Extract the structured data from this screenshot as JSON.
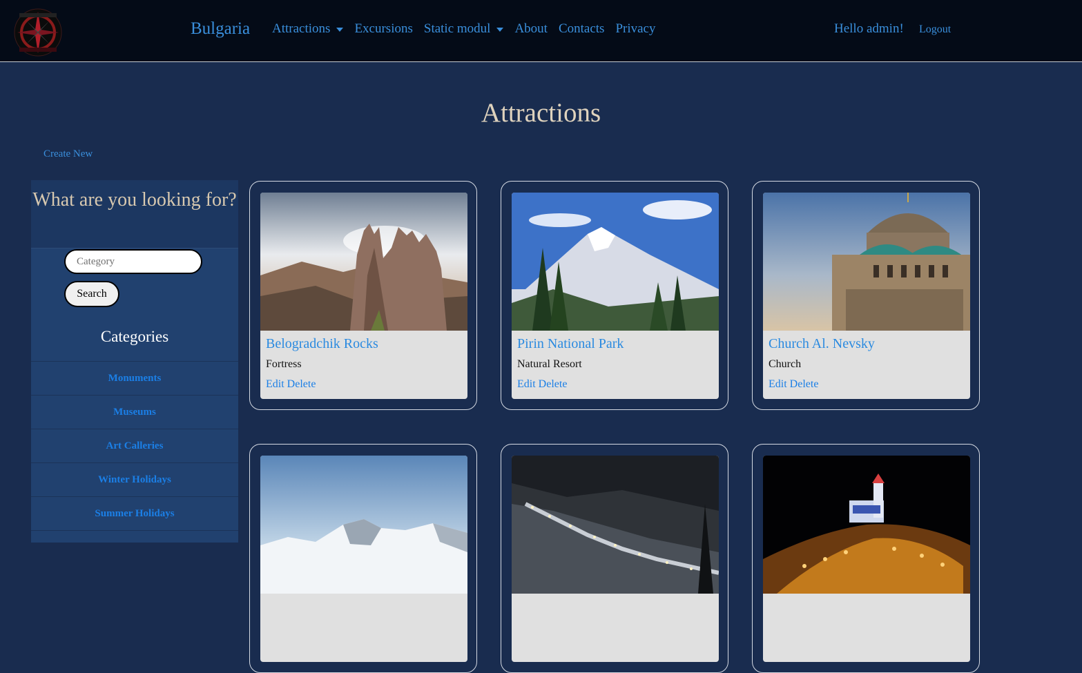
{
  "nav": {
    "brand": "Bulgaria",
    "links": [
      {
        "label": "Attractions",
        "dropdown": true
      },
      {
        "label": "Excursions",
        "dropdown": false
      },
      {
        "label": "Static modul",
        "dropdown": true
      },
      {
        "label": "About",
        "dropdown": false
      },
      {
        "label": "Contacts",
        "dropdown": false
      },
      {
        "label": "Privacy",
        "dropdown": false
      }
    ],
    "greeting": "Hello admin!",
    "logout": "Logout"
  },
  "page": {
    "title": "Attractions",
    "create_new": "Create New"
  },
  "sidebar": {
    "heading": "What are you looking for?",
    "search": {
      "placeholder": "Category",
      "value": "",
      "button": "Search"
    },
    "categories_title": "Categories",
    "categories": [
      "Monuments",
      "Museums",
      "Art Calleries",
      "Winter Holidays",
      "Summer Holidays"
    ]
  },
  "cards": [
    {
      "title": "Belogradchik Rocks",
      "category": "Fortress",
      "edit": "Edit",
      "delete": "Delete"
    },
    {
      "title": "Pirin National Park",
      "category": "Natural Resort",
      "edit": "Edit",
      "delete": "Delete"
    },
    {
      "title": "Church Al. Nevsky",
      "category": "Church",
      "edit": "Edit",
      "delete": "Delete"
    },
    {
      "title": "",
      "category": "",
      "edit": "",
      "delete": ""
    },
    {
      "title": "",
      "category": "",
      "edit": "",
      "delete": ""
    },
    {
      "title": "",
      "category": "",
      "edit": "",
      "delete": ""
    }
  ],
  "colors": {
    "page_bg": "#192c4f",
    "navbar_bg": "#040b17",
    "link": "#3a8fdc",
    "title": "#ded2bd",
    "sidebar_bg": "#21416f",
    "card_bg": "#e0e0e0"
  }
}
